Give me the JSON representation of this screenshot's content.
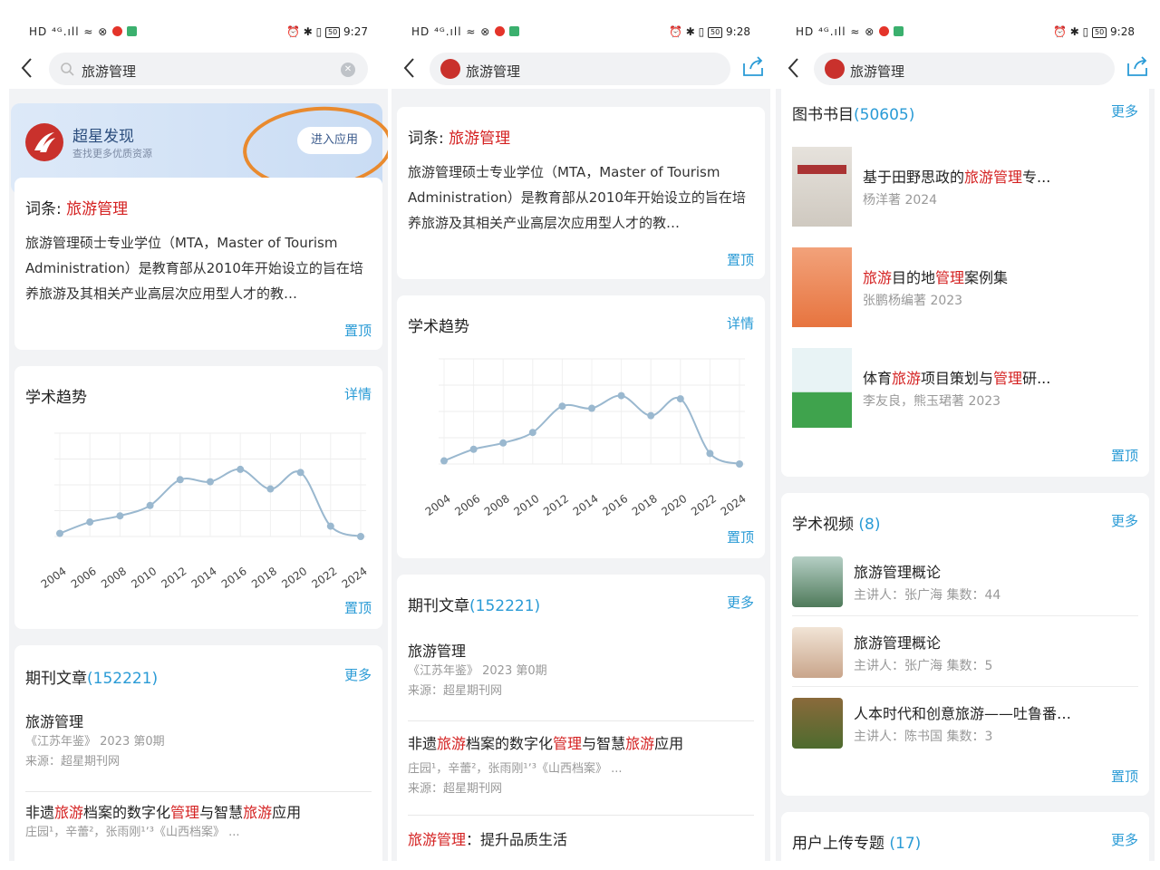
{
  "status": {
    "left": "HD ⁴ᴳ.ıll ≈ ⊗",
    "batt": "50",
    "time1": "9:27",
    "time2": "9:28",
    "time3": "9:28"
  },
  "search": {
    "query": "旅游管理"
  },
  "banner": {
    "title": "超星发现",
    "subtitle": "查找更多优质资源",
    "button": "进入应用"
  },
  "entry": {
    "label": "词条:",
    "term": "旅游管理",
    "desc": "旅游管理硕士专业学位（MTA，Master of Tourism Administration）是教育部从2010年开始设立的旨在培养旅游及其相关产业高层次应用型人才的教…",
    "pin": "置顶"
  },
  "trend": {
    "title": "学术趋势",
    "detail": "详情",
    "pin": "置顶"
  },
  "chart_data": {
    "type": "line",
    "categories": [
      "2004",
      "2006",
      "2008",
      "2010",
      "2012",
      "2014",
      "2016",
      "2018",
      "2020",
      "2022",
      "2024"
    ],
    "values": [
      3,
      14,
      20,
      30,
      55,
      53,
      65,
      46,
      62,
      10,
      0
    ],
    "ylim": [
      0,
      100
    ],
    "grid": true
  },
  "journal": {
    "title": "期刊文章",
    "count": "(152221)",
    "more": "更多",
    "items": [
      {
        "title_red": "旅游管理",
        "meta1": "《江苏年鉴》 2023 第0期",
        "meta2": "来源：超星期刊网"
      },
      {
        "t1": "非遗",
        "t2": "旅游",
        "t3": "档案的数字化",
        "t4": "管理",
        "t5": "与智慧",
        "t6": "旅游",
        "t7": "应用",
        "meta1": "庄园¹，辛蕾²，张雨刚¹ʼ³《山西档案》 ...",
        "meta2": "来源：超星期刊网"
      },
      {
        "t1": "旅游管理",
        "t2": "：提升品质生活"
      }
    ]
  },
  "books": {
    "title": "图书书目",
    "count": "(50605)",
    "more": "更多",
    "pin": "置顶",
    "items": [
      {
        "a": "基于田野思政的",
        "b": "旅游管理",
        "c": "专...",
        "author": "杨洋著  2024"
      },
      {
        "a": "旅游",
        "b": "目的地",
        "c": "管理",
        "d": "案例集",
        "author": "张鹏杨编著  2023"
      },
      {
        "a": "体育",
        "b": "旅游",
        "c": "项目策划与",
        "d": "管理",
        "e": "研...",
        "author": "李友良，熊玉珺著  2023"
      }
    ]
  },
  "videos": {
    "title": "学术视频",
    "count": "(8)",
    "more": "更多",
    "pin": "置顶",
    "items": [
      {
        "title": "旅游管理概论",
        "meta": "主讲人：张广海  集数：44"
      },
      {
        "title": "旅游管理概论",
        "meta": "主讲人：张广海  集数：5"
      },
      {
        "title": "人本时代和创意旅游——吐鲁番…",
        "meta": "主讲人：陈书国  集数：3"
      }
    ]
  },
  "uploads": {
    "title": "用户上传专题",
    "count": "(17)",
    "more": "更多"
  }
}
